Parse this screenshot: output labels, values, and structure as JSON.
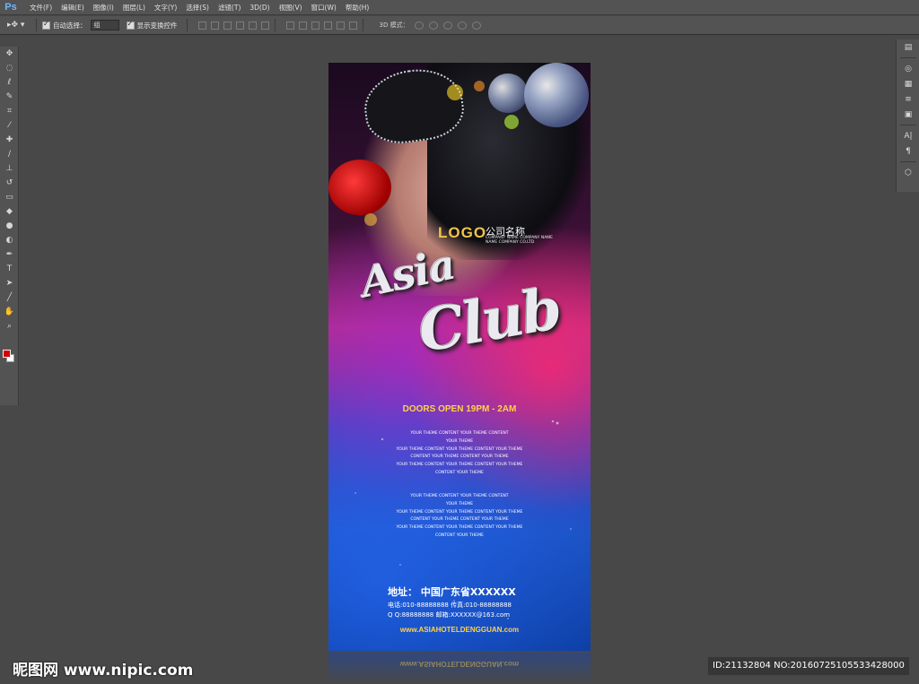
{
  "app": {
    "logo": "Ps"
  },
  "menu": [
    "文件(F)",
    "编辑(E)",
    "图像(I)",
    "图层(L)",
    "文字(Y)",
    "选择(S)",
    "滤镜(T)",
    "3D(D)",
    "视图(V)",
    "窗口(W)",
    "帮助(H)"
  ],
  "options": {
    "auto_select_label": "自动选择：",
    "auto_select_value": "组",
    "show_transform_label": "显示变换控件",
    "mode_3d_label": "3D 模式："
  },
  "poster": {
    "logo": "LOGO",
    "company_cn": "公司名称",
    "company_en1": "COMPANY NAME COMPANY NAME",
    "company_en2": "NAME COMPANY CO.LTD",
    "title_1": "Asia",
    "title_2": "Club",
    "doors": "DOORS OPEN 19PM - 2AM",
    "block1": [
      "YOUR THEME CONTENT YOUR THEME CONTENT",
      "YOUR THEME",
      "YOUR THEME CONTENT YOUR THEME CONTENT YOUR THEME",
      "CONTENT YOUR THEME CONTENT YOUR THEME",
      "YOUR THEME CONTENT YOUR THEME CONTENT YOUR THEME",
      "CONTENT YOUR THEME"
    ],
    "block2": [
      "YOUR THEME CONTENT YOUR THEME CONTENT",
      "YOUR THEME",
      "YOUR THEME CONTENT YOUR THEME CONTENT YOUR THEME",
      "CONTENT YOUR THEME CONTENT YOUR THEME",
      "YOUR THEME CONTENT YOUR THEME CONTENT YOUR THEME",
      "CONTENT YOUR THEME"
    ],
    "address": "地址：  中国广东省XXXXXX",
    "phone": "电话:010-88888888  传真:010-88888888",
    "qq": "Q Q:88888888  邮箱:XXXXXX@163.com",
    "website": "www.ASIAHOTELDENGGUAN.com"
  },
  "watermark": {
    "site": "昵图网 www.nipic.com",
    "id": "ID:21132804 NO:20160725105533428000"
  }
}
